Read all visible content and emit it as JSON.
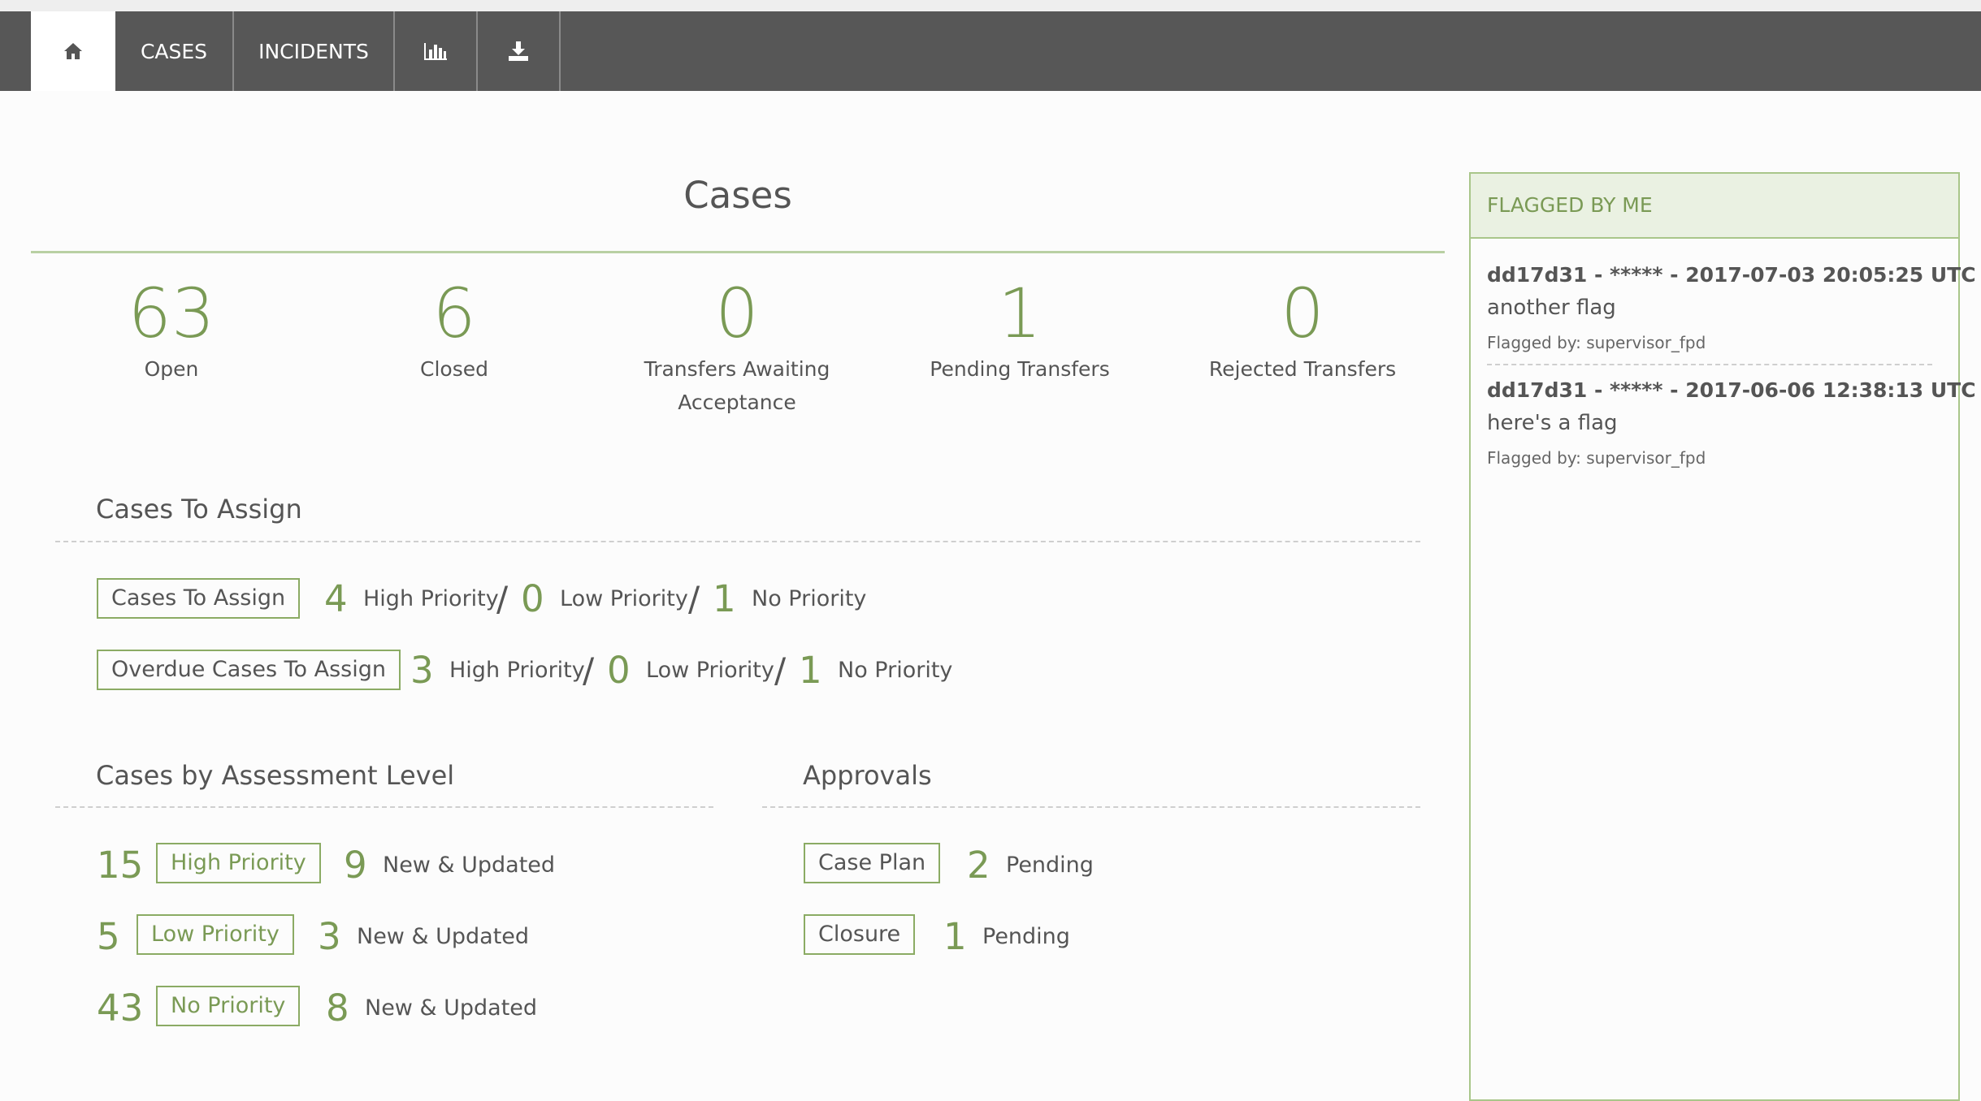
{
  "nav": {
    "home_icon": "home-icon",
    "cases_label": "CASES",
    "incidents_label": "INCIDENTS",
    "chart_icon": "bar-chart-icon",
    "download_icon": "download-icon"
  },
  "page_title": "Cases",
  "stats": [
    {
      "value": "63",
      "label": "Open"
    },
    {
      "value": "6",
      "label": "Closed"
    },
    {
      "value": "0",
      "label": "Transfers Awaiting Acceptance"
    },
    {
      "value": "1",
      "label": "Pending Transfers"
    },
    {
      "value": "0",
      "label": "Rejected Transfers"
    }
  ],
  "cases_to_assign": {
    "title": "Cases To Assign",
    "rows": [
      {
        "button": "Cases To Assign",
        "high": "4",
        "high_label": "High Priority",
        "low": "0",
        "low_label": "Low Priority",
        "none": "1",
        "none_label": "No Priority"
      },
      {
        "button": "Overdue Cases To Assign",
        "high": "3",
        "high_label": "High Priority",
        "low": "0",
        "low_label": "Low Priority",
        "none": "1",
        "none_label": "No Priority"
      }
    ],
    "slash": "/"
  },
  "assessment": {
    "title": "Cases by Assessment Level",
    "rows": [
      {
        "count": "15",
        "button": "High Priority",
        "new": "9",
        "new_label": "New & Updated"
      },
      {
        "count": "5",
        "button": "Low Priority",
        "new": "3",
        "new_label": "New & Updated"
      },
      {
        "count": "43",
        "button": "No Priority",
        "new": "8",
        "new_label": "New & Updated"
      }
    ]
  },
  "approvals": {
    "title": "Approvals",
    "rows": [
      {
        "button": "Case Plan",
        "count": "2",
        "label": "Pending"
      },
      {
        "button": "Closure",
        "count": "1",
        "label": "Pending"
      }
    ]
  },
  "flagged": {
    "header": "FLAGGED BY ME",
    "items": [
      {
        "title": "dd17d31 - ***** - 2017-07-03 20:05:25 UTC",
        "message": "another flag",
        "by": "Flagged by: supervisor_fpd"
      },
      {
        "title": "dd17d31 - ***** - 2017-06-06 12:38:13 UTC",
        "message": "here's a flag",
        "by": "Flagged by: supervisor_fpd"
      }
    ]
  },
  "colors": {
    "accent": "#7a9a55",
    "nav": "#575757",
    "border": "#8bab64"
  }
}
